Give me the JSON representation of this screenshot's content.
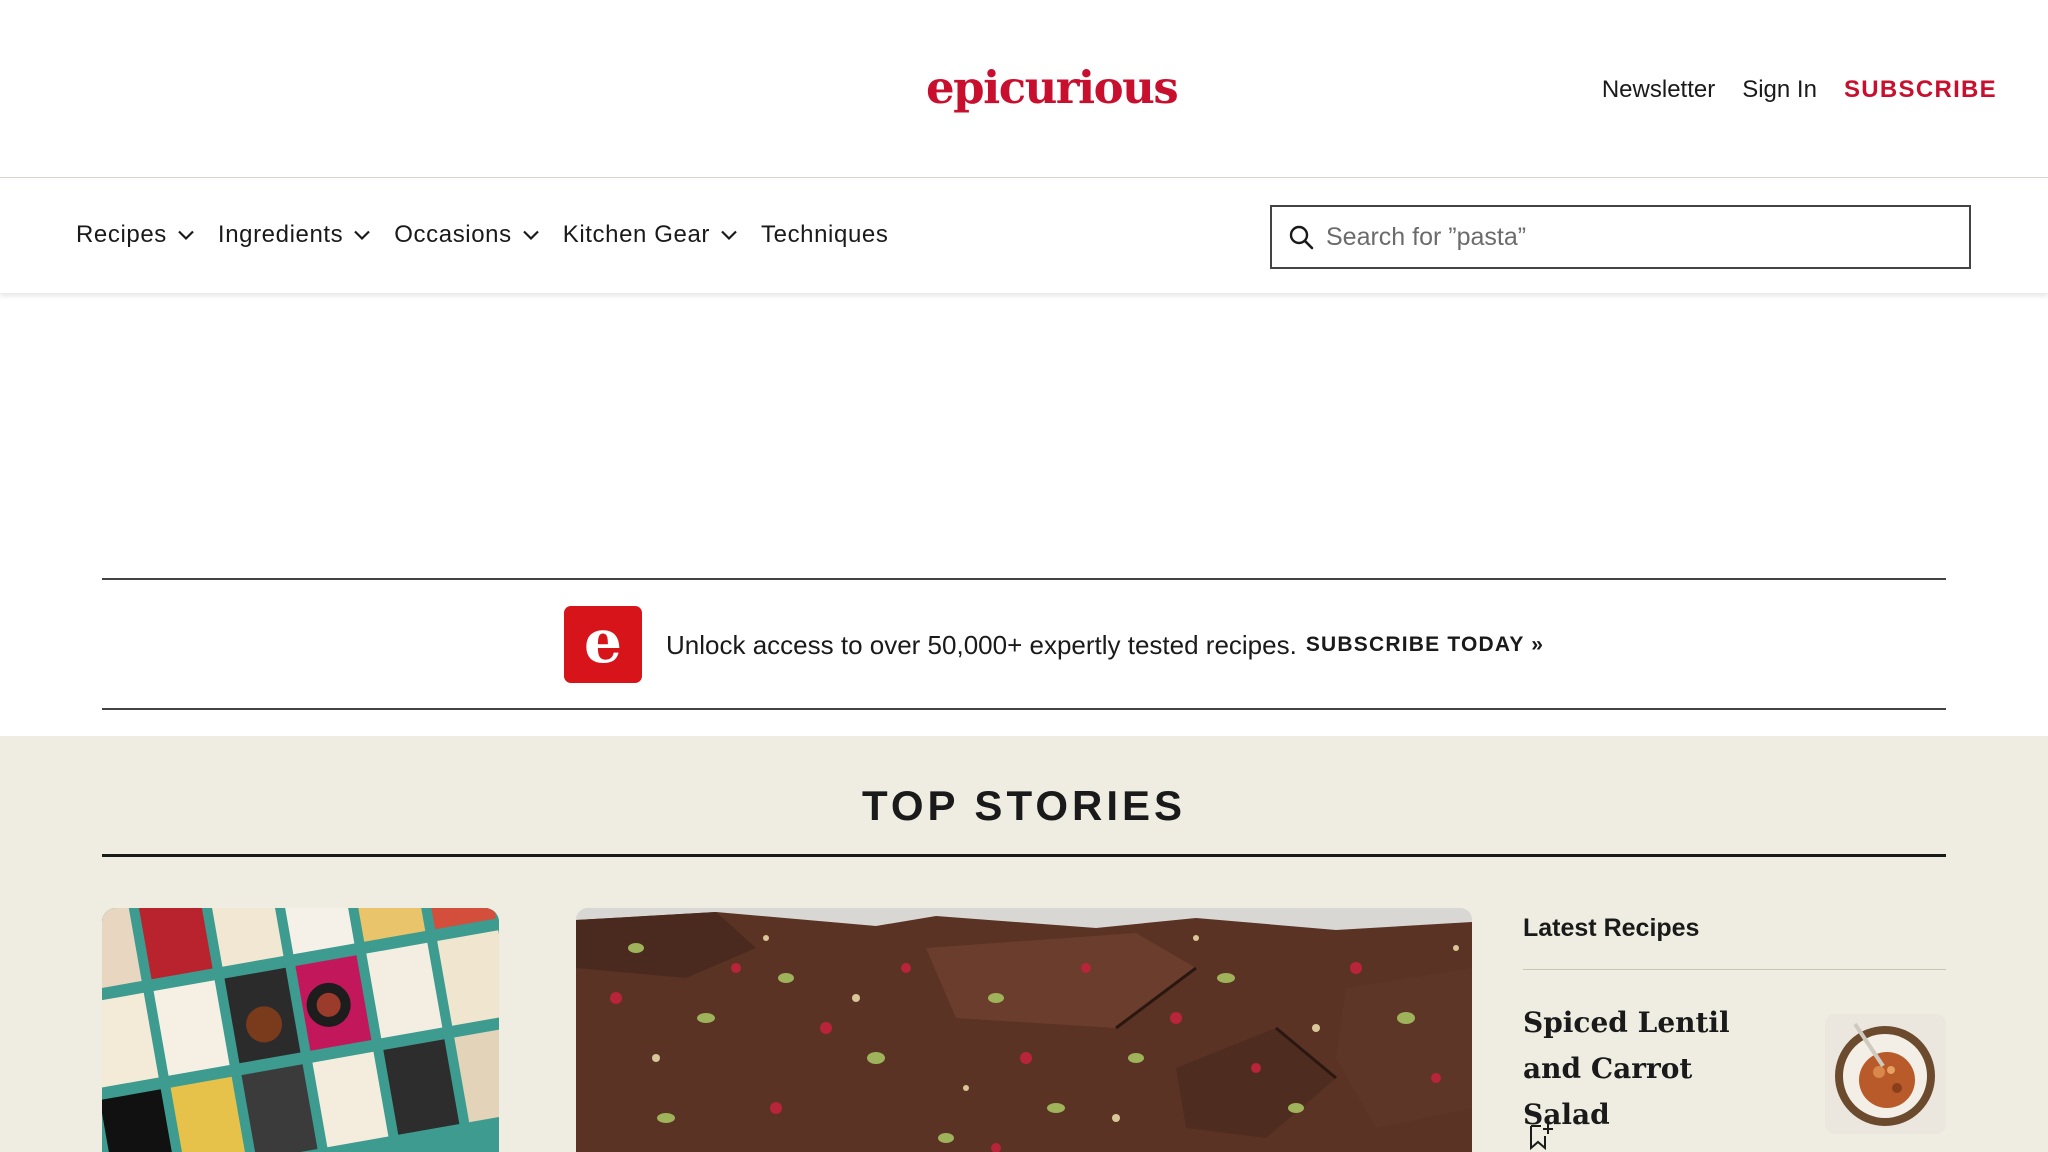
{
  "brand": {
    "logo_text": "epicurious",
    "accent": "#c8102e"
  },
  "header": {
    "links": {
      "newsletter": "Newsletter",
      "sign_in": "Sign In",
      "subscribe": "SUBSCRIBE"
    }
  },
  "nav": {
    "items": [
      {
        "label": "Recipes",
        "has_dropdown": true
      },
      {
        "label": "Ingredients",
        "has_dropdown": true
      },
      {
        "label": "Occasions",
        "has_dropdown": true
      },
      {
        "label": "Kitchen Gear",
        "has_dropdown": true
      },
      {
        "label": "Techniques",
        "has_dropdown": false
      }
    ],
    "search": {
      "placeholder": "Search for ”pasta”",
      "value": "",
      "icon": "search-icon"
    }
  },
  "promo": {
    "logo_letter": "e",
    "text": "Unlock access to over 50,000+ expertly tested recipes.",
    "cta": "SUBSCRIBE TODAY",
    "cta_suffix": "»"
  },
  "top_stories": {
    "title": "TOP STORIES",
    "background": "#efede1",
    "latest": {
      "heading": "Latest Recipes",
      "items": [
        {
          "title": "Spiced Lentil and Carrot Salad",
          "icon": "bookmark-plus-icon"
        }
      ]
    }
  }
}
